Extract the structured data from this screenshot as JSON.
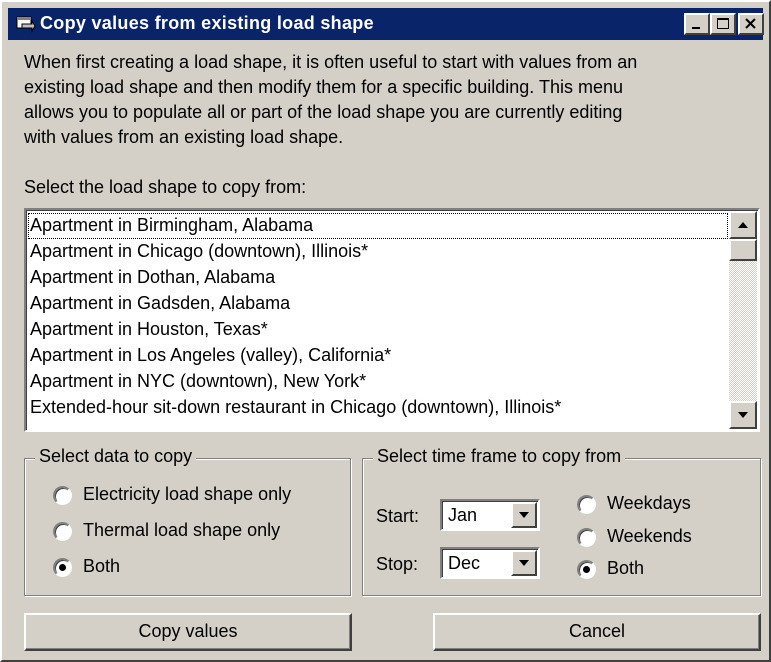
{
  "window": {
    "title": "Copy values from existing load shape",
    "icon": "window-app-icon",
    "controls": [
      "minimize-icon",
      "maximize-icon",
      "close-icon"
    ]
  },
  "intro_lines": [
    "When first creating a load shape, it is often useful to start with values from an",
    "existing load shape and then modify them for a specific building.  This menu",
    "allows you to populate all or part of the load shape you are currently editing",
    "with values from an existing load shape."
  ],
  "list": {
    "label": "Select the load shape to copy from:",
    "items": [
      "Apartment in Birmingham, Alabama",
      "Apartment in Chicago (downtown), Illinois*",
      "Apartment in Dothan, Alabama",
      "Apartment in Gadsden, Alabama",
      "Apartment in Houston, Texas*",
      "Apartment in Los Angeles (valley), California*",
      "Apartment in NYC (downtown), New York*",
      "Extended-hour sit-down restaurant in Chicago (downtown), Illinois*"
    ],
    "selected_index": 0
  },
  "data_group": {
    "legend": "Select data to copy",
    "options": [
      {
        "label": "Electricity load shape only",
        "checked": false
      },
      {
        "label": "Thermal load shape only",
        "checked": false
      },
      {
        "label": "Both",
        "checked": true
      }
    ]
  },
  "time_group": {
    "legend": "Select time frame to copy from",
    "start_label": "Start:",
    "start_value": "Jan",
    "stop_label": "Stop:",
    "stop_value": "Dec",
    "options": [
      {
        "label": "Weekdays",
        "checked": false
      },
      {
        "label": "Weekends",
        "checked": false
      },
      {
        "label": "Both",
        "checked": true
      }
    ]
  },
  "buttons": {
    "copy": "Copy values",
    "cancel": "Cancel"
  }
}
